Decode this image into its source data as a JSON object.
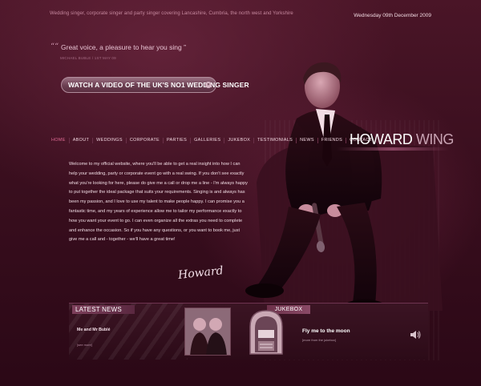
{
  "header": {
    "tagline": "Wedding singer, corporate singer and party singer covering Lancashire, Cumbria, the north west and Yorkshire",
    "date": "Wednesday 09th December 2009"
  },
  "quote": {
    "mark": "““",
    "text": "Great voice, a pleasure to hear you sing ”",
    "source": "MICHAEL BUBLE / 1ST MAY 09"
  },
  "video_button": {
    "label": "WATCH A VIDEO OF THE UK'S NO1 WEDDING SINGER",
    "arrow": "»"
  },
  "nav": [
    "HOME",
    "ABOUT",
    "WEDDINGS",
    "CORPORATE",
    "PARTIES",
    "GALLERIES",
    "JUKEBOX",
    "TESTIMONIALS",
    "NEWS",
    "FRIENDS",
    "CONTACT"
  ],
  "brand": {
    "first": "HOWARD",
    "last": "WING"
  },
  "welcome": {
    "text": "Welcome to my official website, where you'll be able to get a real insight into how I can help your wedding, party or corporate event go with a real swing. If you don't see exactly what you're looking for here, please do give me a call or drop me a line - I'm always happy to put together the ideal package that suits your requirements. Singing is and always has been my passion, and I love to use my talent to make people happy. I can promise you a fantastic time, and my years of experience allow me to tailor my performance exactly to how you want your event to go. I can even organize all the extras you need to complete and enhance the occasion. So if you have any questions, or you want to book me, just give me a call and - together - we'll have a great time!",
    "signature": "Howard"
  },
  "latest_news": {
    "heading": "LATEST NEWS",
    "item_title": "Me and Mr Bublé",
    "more": "[see more]"
  },
  "jukebox": {
    "heading": "JUKEBOX",
    "song": "Fly me to the moon",
    "link": "[more from the jukebox]"
  },
  "icons": {
    "speaker": "speaker-icon",
    "jukebox": "jukebox-icon"
  }
}
